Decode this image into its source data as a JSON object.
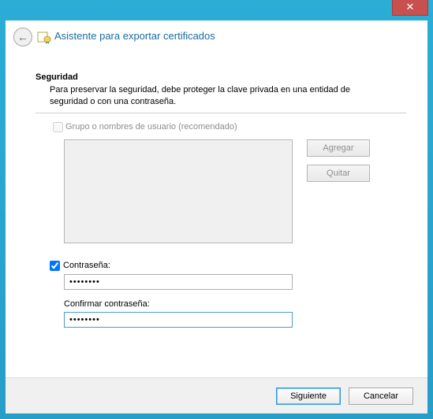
{
  "window": {
    "close_symbol": "✕"
  },
  "header": {
    "back_symbol": "←",
    "title": "Asistente para exportar certificados"
  },
  "security": {
    "heading": "Seguridad",
    "description": "Para preservar la seguridad, debe proteger la clave privada en una entidad de seguridad o con una contraseña.",
    "group_option_label": "Grupo o nombres de usuario (recomendado)",
    "group_option_checked": false,
    "group_option_enabled": false,
    "list_items": [],
    "add_button": "Agregar",
    "remove_button": "Quitar"
  },
  "password": {
    "use_password_label": "Contraseña:",
    "use_password_checked": true,
    "value": "••••••••",
    "confirm_label": "Confirmar contraseña:",
    "confirm_value": "••••••••"
  },
  "footer": {
    "next": "Siguiente",
    "cancel": "Cancelar"
  }
}
